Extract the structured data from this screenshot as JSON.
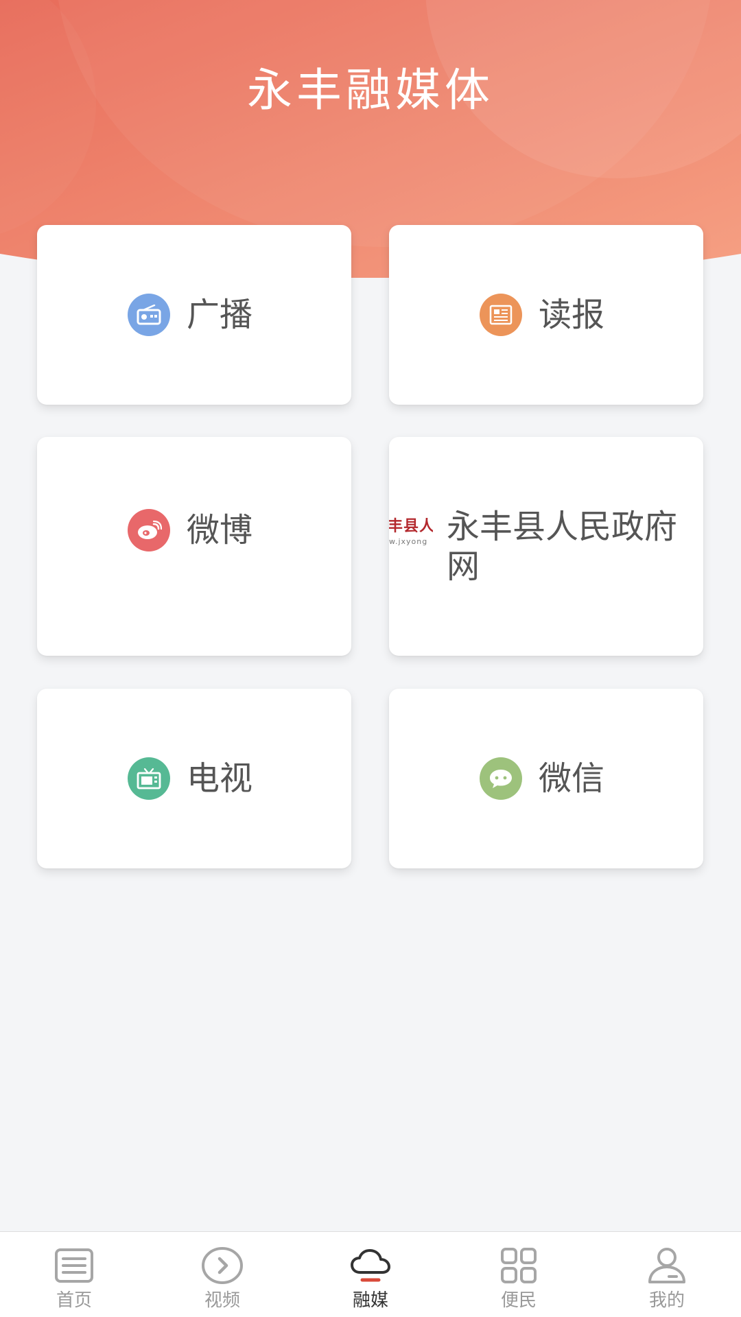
{
  "header": {
    "title": "永丰融媒体"
  },
  "cards": [
    {
      "id": "radio",
      "label": "广播",
      "icon": "radio-icon",
      "icon_color": "#79a5e5"
    },
    {
      "id": "newspaper",
      "label": "读报",
      "icon": "newspaper-icon",
      "icon_color": "#ec9459"
    },
    {
      "id": "weibo",
      "label": "微博",
      "icon": "weibo-icon",
      "icon_color": "#e8686a"
    },
    {
      "id": "gov",
      "label": "永丰县人民政府网",
      "icon": "gov-logo",
      "logo_text": "丰县人",
      "logo_url": "w.jxyong"
    },
    {
      "id": "tv",
      "label": "电视",
      "icon": "tv-icon",
      "icon_color": "#56b994"
    },
    {
      "id": "wechat",
      "label": "微信",
      "icon": "wechat-icon",
      "icon_color": "#9dc27c"
    }
  ],
  "nav": {
    "items": [
      {
        "id": "home",
        "label": "首页",
        "icon": "news-list-icon",
        "active": false
      },
      {
        "id": "video",
        "label": "视频",
        "icon": "play-circle-icon",
        "active": false
      },
      {
        "id": "media",
        "label": "融媒",
        "icon": "cloud-icon",
        "active": true
      },
      {
        "id": "services",
        "label": "便民",
        "icon": "grid-icon",
        "active": false
      },
      {
        "id": "mine",
        "label": "我的",
        "icon": "user-icon",
        "active": false
      }
    ]
  },
  "colors": {
    "header_gradient_start": "#e96f5c",
    "header_gradient_end": "#f59b7e",
    "active_indicator": "#d94a3a",
    "background": "#f4f5f7"
  }
}
